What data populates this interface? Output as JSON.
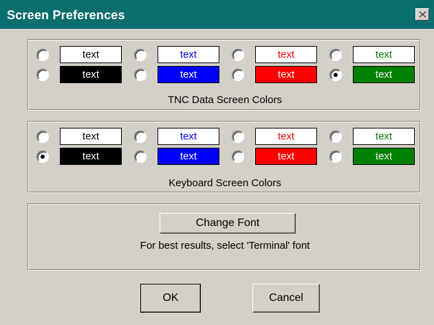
{
  "window": {
    "title": "Screen Preferences"
  },
  "tnc_group": {
    "caption": "TNC Data Screen Colors",
    "options": [
      {
        "text": "text",
        "fg": "#000000",
        "bg": "#ffffff",
        "checked": false
      },
      {
        "text": "text",
        "fg": "#0000ff",
        "bg": "#ffffff",
        "checked": false
      },
      {
        "text": "text",
        "fg": "#ff0000",
        "bg": "#ffffff",
        "checked": false
      },
      {
        "text": "text",
        "fg": "#008000",
        "bg": "#ffffff",
        "checked": false
      },
      {
        "text": "text",
        "fg": "#ffffff",
        "bg": "#000000",
        "checked": false
      },
      {
        "text": "text",
        "fg": "#ffffff",
        "bg": "#0000ff",
        "checked": false
      },
      {
        "text": "text",
        "fg": "#ffffff",
        "bg": "#ff0000",
        "checked": false
      },
      {
        "text": "text",
        "fg": "#ffffff",
        "bg": "#008000",
        "checked": true
      }
    ]
  },
  "keyboard_group": {
    "caption": "Keyboard Screen Colors",
    "options": [
      {
        "text": "text",
        "fg": "#000000",
        "bg": "#ffffff",
        "checked": false
      },
      {
        "text": "text",
        "fg": "#0000ff",
        "bg": "#ffffff",
        "checked": false
      },
      {
        "text": "text",
        "fg": "#ff0000",
        "bg": "#ffffff",
        "checked": false
      },
      {
        "text": "text",
        "fg": "#008000",
        "bg": "#ffffff",
        "checked": false
      },
      {
        "text": "text",
        "fg": "#ffffff",
        "bg": "#000000",
        "checked": true
      },
      {
        "text": "text",
        "fg": "#ffffff",
        "bg": "#0000ff",
        "checked": false
      },
      {
        "text": "text",
        "fg": "#ffffff",
        "bg": "#ff0000",
        "checked": false
      },
      {
        "text": "text",
        "fg": "#ffffff",
        "bg": "#008000",
        "checked": false
      }
    ]
  },
  "font_group": {
    "button_label": "Change Font",
    "hint": "For best results, select 'Terminal' font"
  },
  "buttons": {
    "ok": "OK",
    "cancel": "Cancel"
  }
}
